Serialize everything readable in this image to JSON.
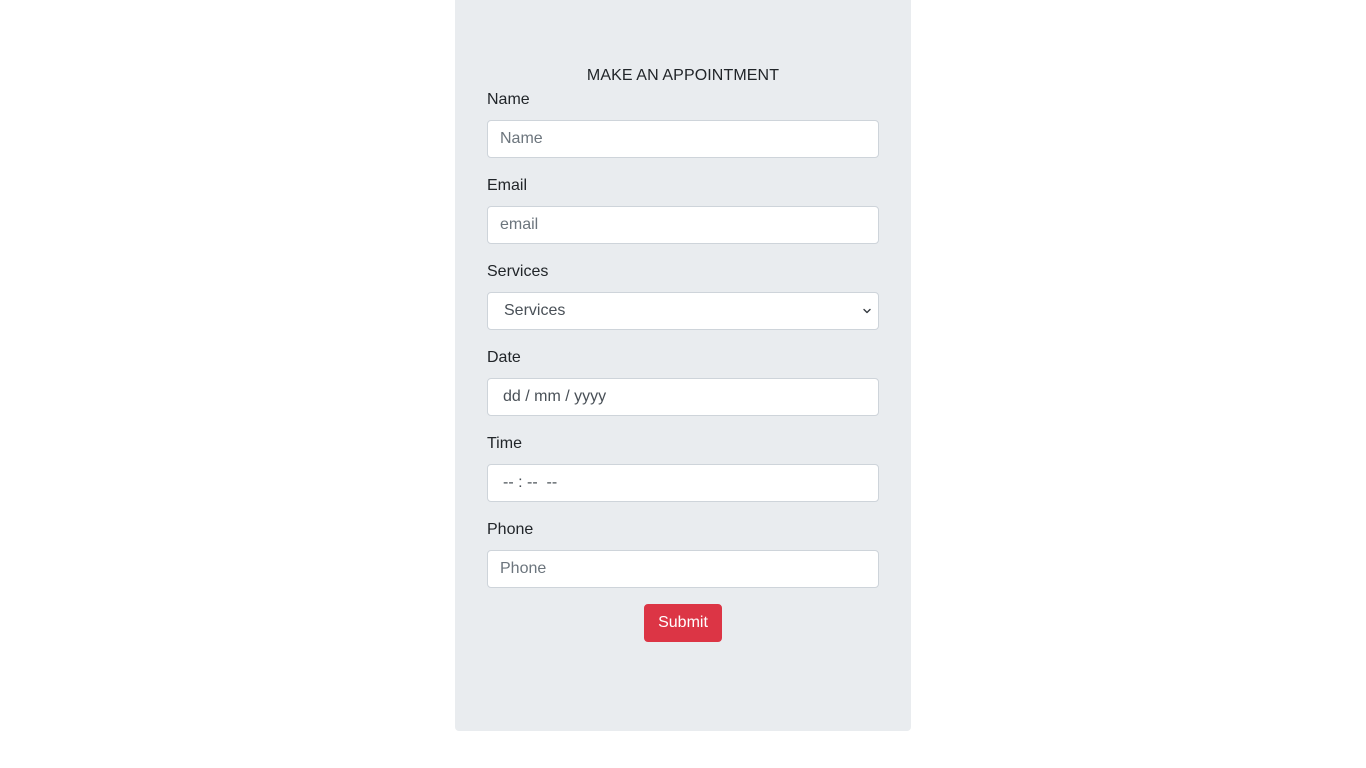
{
  "form": {
    "title": "MAKE AN APPOINTMENT",
    "name": {
      "label": "Name",
      "placeholder": "Name"
    },
    "email": {
      "label": "Email",
      "placeholder": "email"
    },
    "services": {
      "label": "Services",
      "selected": "Services"
    },
    "date": {
      "label": "Date",
      "placeholder": "dd / mm / yyyy"
    },
    "time": {
      "label": "Time",
      "placeholder": "-- : --  --"
    },
    "phone": {
      "label": "Phone",
      "placeholder": "Phone"
    },
    "submit_label": "Submit"
  },
  "colors": {
    "card_background": "#e9ecef",
    "submit_button": "#dc3545"
  },
  "icons": {
    "services_dropdown": "chevron-down-icon"
  }
}
